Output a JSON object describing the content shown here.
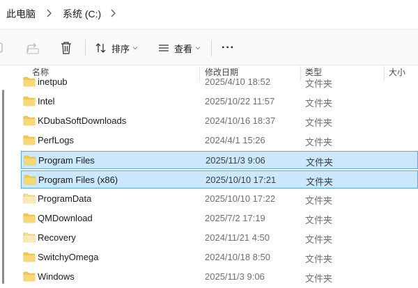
{
  "breadcrumb": {
    "items": [
      "此电脑",
      "系统 (C:)"
    ]
  },
  "toolbar": {
    "sort_label": "排序",
    "view_label": "查看",
    "more_label": "···"
  },
  "columns": {
    "name": "名称",
    "modified": "修改日期",
    "type": "类型",
    "size": "大小"
  },
  "files": [
    {
      "name": "inetpub",
      "modified": "2025/4/10 18:52",
      "type": "文件夹",
      "selected": false,
      "faded": false
    },
    {
      "name": "Intel",
      "modified": "2025/10/22 11:57",
      "type": "文件夹",
      "selected": false,
      "faded": false
    },
    {
      "name": "KDubaSoftDownloads",
      "modified": "2024/10/16 18:37",
      "type": "文件夹",
      "selected": false,
      "faded": false
    },
    {
      "name": "PerfLogs",
      "modified": "2024/4/1 15:26",
      "type": "文件夹",
      "selected": false,
      "faded": false
    },
    {
      "name": "Program Files",
      "modified": "2025/11/3 9:06",
      "type": "文件夹",
      "selected": true,
      "faded": false
    },
    {
      "name": "Program Files (x86)",
      "modified": "2025/10/10 17:21",
      "type": "文件夹",
      "selected": true,
      "faded": false
    },
    {
      "name": "ProgramData",
      "modified": "2025/10/10 17:22",
      "type": "文件夹",
      "selected": false,
      "faded": true
    },
    {
      "name": "QMDownload",
      "modified": "2025/7/2 17:19",
      "type": "文件夹",
      "selected": false,
      "faded": false
    },
    {
      "name": "Recovery",
      "modified": "2024/11/21 4:50",
      "type": "文件夹",
      "selected": false,
      "faded": true
    },
    {
      "name": "SwitchyOmega",
      "modified": "2024/10/18 8:50",
      "type": "文件夹",
      "selected": false,
      "faded": false
    },
    {
      "name": "Windows",
      "modified": "2025/11/3 9:06",
      "type": "文件夹",
      "selected": false,
      "faded": false
    },
    {
      "name": "",
      "modified": "",
      "type": "",
      "selected": false,
      "faded": false
    }
  ],
  "icons": {
    "folder": "folder-icon",
    "copy_path": "copy-icon",
    "share": "share-icon",
    "delete": "trash-icon",
    "sort": "sort-icon",
    "view": "view-icon",
    "more": "more-icon",
    "chevron": "chevron-right-icon"
  },
  "colors": {
    "folder": "#f2c94c",
    "folder_faded": "#f7df9a",
    "selection_bg": "#cce8ff",
    "selection_border": "#5ea7e0"
  }
}
